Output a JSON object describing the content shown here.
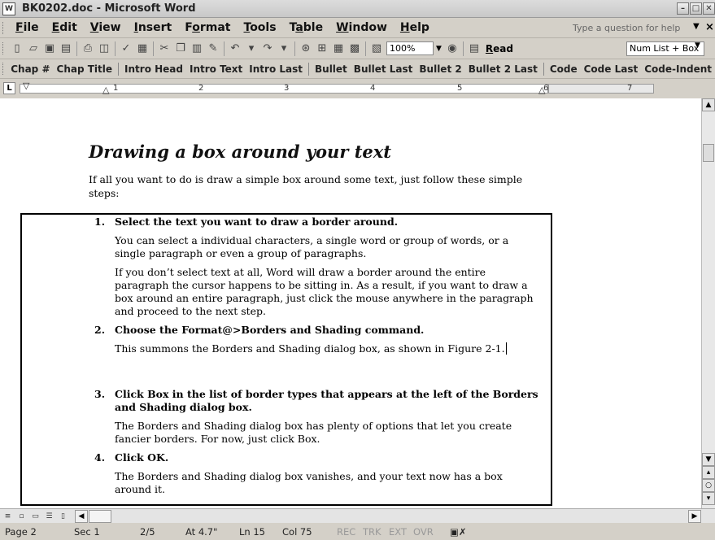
{
  "window": {
    "app_icon": "W",
    "title": "BK0202.doc - Microsoft Word",
    "buttons": [
      "–",
      "□",
      "✕"
    ]
  },
  "menubar": {
    "items": [
      {
        "u": "F",
        "rest": "ile"
      },
      {
        "u": "E",
        "rest": "dit"
      },
      {
        "u": "V",
        "rest": "iew"
      },
      {
        "u": "I",
        "rest": "nsert"
      },
      {
        "pre": "F",
        "u": "o",
        "rest": "rmat"
      },
      {
        "u": "T",
        "rest": "ools"
      },
      {
        "pre": "T",
        "u": "a",
        "rest": "ble"
      },
      {
        "u": "W",
        "rest": "indow"
      },
      {
        "u": "H",
        "rest": "elp"
      }
    ],
    "help_placeholder": "Type a question for help",
    "close": "×"
  },
  "toolbar": {
    "icons": [
      "new-icon",
      "open-icon",
      "save-icon",
      "permission-icon",
      "print-icon",
      "print-preview-icon",
      "spelling-icon",
      "research-icon",
      "cut-icon",
      "copy-icon",
      "paste-icon",
      "format-painter-icon",
      "undo-icon",
      "redo-icon",
      "hyperlink-icon",
      "tables-borders-icon",
      "insert-table-icon",
      "excel-icon",
      "document-map-icon"
    ],
    "zoom": "100%",
    "read_prefix": "",
    "read_u": "R",
    "read_rest": "ead",
    "style_box": "Num List + Box"
  },
  "styles": {
    "items": [
      "Chap #",
      "Chap Title",
      "|",
      "Intro Head",
      "Intro Text",
      "Intro Last",
      "|",
      "Bullet",
      "Bullet Last",
      "Bullet 2",
      "Bullet 2 Last",
      "|",
      "Code",
      "Code Last",
      "Code-Indent"
    ]
  },
  "ruler": {
    "numbers": [
      "1",
      "2",
      "3",
      "4",
      "5",
      "6",
      "7"
    ]
  },
  "document": {
    "heading": "Drawing a box around your text",
    "intro": "If all you want to do is draw a simple box around some text, just follow these simple steps:",
    "steps": [
      {
        "num": "1.",
        "head": "Select the text you want to draw a border around.",
        "paras": [
          "You can select a individual characters, a single word or group of words, or a single paragraph or even a group of paragraphs.",
          "If you don’t select text at all, Word will draw a border around the entire paragraph the cursor happens to be sitting in. As a result, if you want to draw a box around an entire paragraph, just click the mouse anywhere in the paragraph and proceed to the next step."
        ]
      },
      {
        "num": "2.",
        "head": "Choose the Format@>Borders and Shading command.",
        "paras": [
          "This summons the Borders and Shading dialog box, as shown in Figure 2-1."
        ]
      },
      {
        "num": "3.",
        "head": "Click Box in the list of border types that appears at the left of the Borders and Shading dialog box.",
        "paras": [
          "The Borders and Shading dialog box has plenty of options that let you create fancier borders. For now, just click Box."
        ]
      },
      {
        "num": "4.",
        "head": "Click OK.",
        "paras": [
          "The Borders and Shading dialog box vanishes, and your text now has a box around it."
        ]
      }
    ]
  },
  "statusbar": {
    "page": "Page 2",
    "sec": "Sec 1",
    "pages": "2/5",
    "at": "At 4.7\"",
    "ln": "Ln 15",
    "col": "Col 75",
    "rec": "REC",
    "trk": "TRK",
    "ext": "EXT",
    "ovr": "OVR"
  }
}
